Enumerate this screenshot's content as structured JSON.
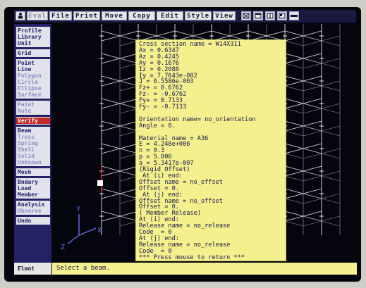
{
  "menu": {
    "items": [
      {
        "label": "Eval",
        "dim": true
      },
      {
        "label": "File",
        "dim": false
      },
      {
        "label": "Print",
        "dim": false
      },
      {
        "label": "Move",
        "dim": false
      },
      {
        "label": "Copy",
        "dim": false
      },
      {
        "label": "Edit",
        "dim": false
      },
      {
        "label": "Style",
        "dim": false
      },
      {
        "label": "View",
        "dim": false
      }
    ],
    "icons": [
      "person-icon",
      "zoom-box-icon",
      "window-icon",
      "split-view-icon",
      "layout-icon",
      "close-window-icon"
    ]
  },
  "sidebar": {
    "groups": [
      {
        "items": [
          {
            "label": "Profile",
            "dim": false
          },
          {
            "label": "Library",
            "dim": false
          },
          {
            "label": "Unit",
            "dim": false
          }
        ]
      },
      {
        "items": [
          {
            "label": "Grid",
            "dim": false
          }
        ]
      },
      {
        "items": [
          {
            "label": "Point",
            "dim": false
          },
          {
            "label": "Line",
            "dim": false
          },
          {
            "label": "Polygon",
            "dim": true
          },
          {
            "label": "Circle",
            "dim": true
          },
          {
            "label": "Ellipse",
            "dim": true
          },
          {
            "label": "Surface",
            "dim": true
          }
        ]
      },
      {
        "items": [
          {
            "label": "Paint",
            "dim": true
          },
          {
            "label": "Note",
            "dim": true
          }
        ]
      },
      {
        "items": [
          {
            "label": "Verify",
            "dim": false,
            "active": true
          }
        ]
      },
      {
        "items": [
          {
            "label": "Beam",
            "dim": false
          },
          {
            "label": "Truss",
            "dim": true
          },
          {
            "label": "Spring",
            "dim": true
          },
          {
            "label": "Shell",
            "dim": true
          },
          {
            "label": "Solid",
            "dim": true
          },
          {
            "label": "Unknown",
            "dim": true
          }
        ]
      },
      {
        "items": [
          {
            "label": "Mesh",
            "dim": false
          }
        ]
      },
      {
        "items": [
          {
            "label": "Bndary",
            "dim": false
          },
          {
            "label": "Load",
            "dim": false
          },
          {
            "label": "Member",
            "dim": false
          }
        ]
      },
      {
        "items": [
          {
            "label": "Analysis",
            "dim": false
          },
          {
            "label": "Observe",
            "dim": true
          }
        ]
      },
      {
        "items": [
          {
            "label": "Undo",
            "dim": false
          }
        ]
      }
    ]
  },
  "axes": {
    "y": "Y",
    "x": "X",
    "z": "Z"
  },
  "popup": {
    "lines": [
      "Cross section name = W14X311",
      "Ax = 0.6347",
      "Az = 0.4245",
      "Ay = 0.1676",
      "Iz = 0.2088",
      "Iy = 7.7643e-002",
      "J = 6.5586e-003",
      "Fz+ = 0.6762",
      "Fz- = -0.6762",
      "Fy+ = 0.7133",
      "Fy- = -0.7133",
      "",
      "Orientation name= no_orientation",
      "Angle = 0.",
      "",
      "Material name = A36",
      "E = 4.248e+006",
      "n = 0.3",
      "p = 5.806",
      "a = 5.3417e-007",
      "(Rigid Offset)",
      " At (i) end:",
      "Offset name = no_offset",
      "Offset = 0.",
      " At (j) end:",
      "Offset name = no_offset",
      "Offset = 0.",
      "( Member Release)",
      "At (i) end:",
      "Release name = no_release",
      "Code  = 0",
      "At (j) end:",
      "Release name = no_release",
      "Code  = 0",
      "*** Press mouse to return ***"
    ]
  },
  "status": {
    "label": "Elmnt",
    "message": "Select a beam."
  },
  "colors": {
    "screen": "#05060d",
    "menu_bg": "#1a1a40",
    "sidebar_bg": "#232266",
    "active": "#c42828",
    "popup_bg": "#f5f08e",
    "truss_line": "#e8e8ee",
    "axis": "#6a6ae6"
  }
}
